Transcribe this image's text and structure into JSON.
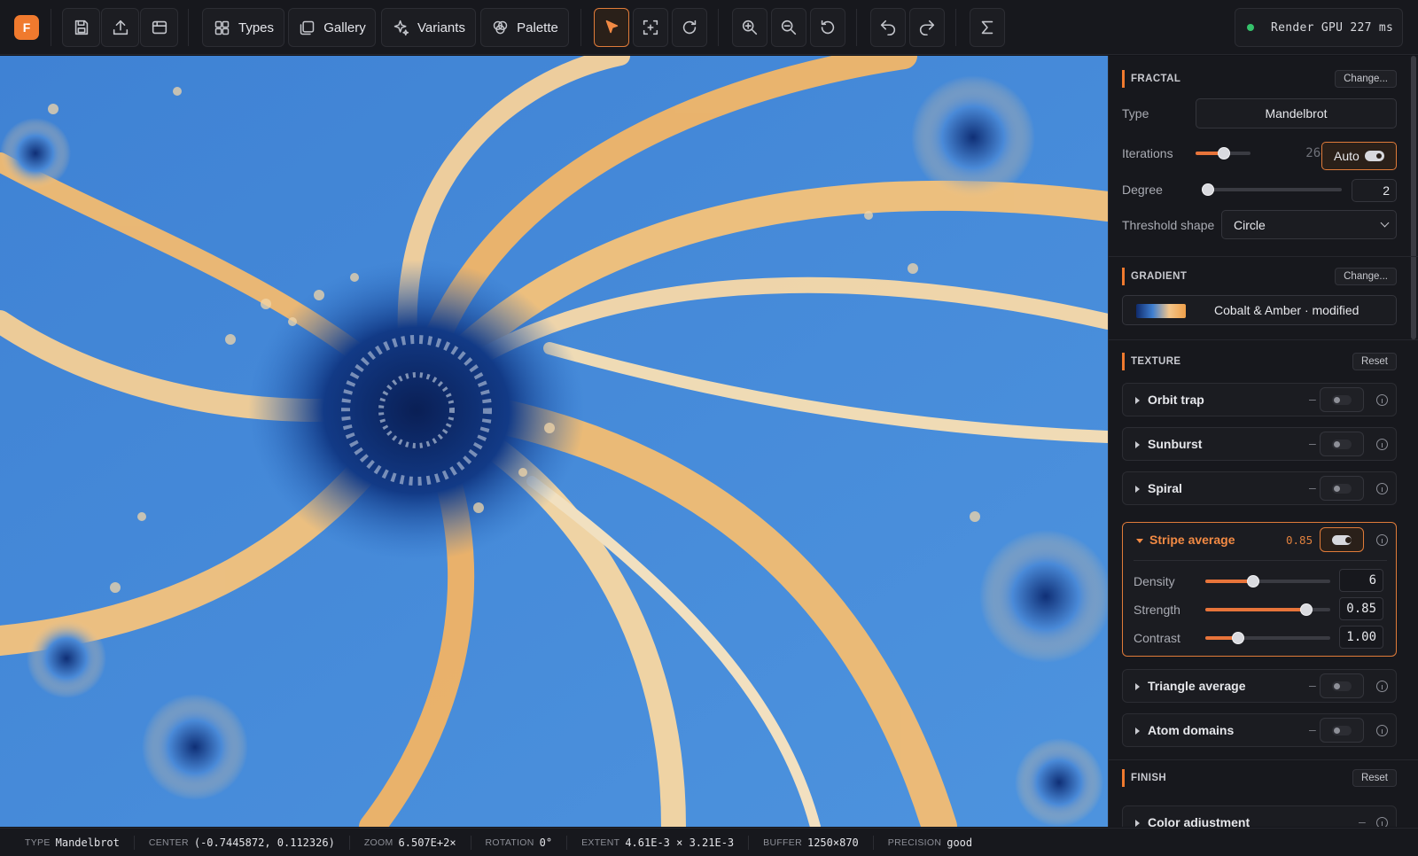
{
  "app": {
    "logo_letter": "F"
  },
  "toolbar": {
    "types_label": "Types",
    "gallery_label": "Gallery",
    "variants_label": "Variants",
    "palette_label": "Palette",
    "render_status": "Render GPU 227 ms",
    "render_status_color": "#35c26b",
    "accent_color": "#f07a2e"
  },
  "panel": {
    "fractal": {
      "section_title": "FRACTAL",
      "change_label": "Change...",
      "type_label": "Type",
      "type_value": "Mandelbrot",
      "iterations_label": "Iterations",
      "iterations_value": "2648",
      "iterations_level": 0.52,
      "auto_label": "Auto",
      "degree_label": "Degree",
      "degree_value": "2",
      "degree_level": 0.0,
      "threshold_label": "Threshold shape",
      "threshold_value": "Circle"
    },
    "gradient": {
      "section_title": "GRADIENT",
      "change_label": "Change...",
      "name": "Cobalt & Amber · modified",
      "swatch_colors": [
        "#0f2a6b",
        "#3f7fd1",
        "#f3c58a",
        "#f0a04a"
      ]
    },
    "texture": {
      "section_title": "TEXTURE",
      "reset_label": "Reset",
      "items": [
        {
          "name": "Orbit trap",
          "value": "–",
          "enabled": false
        },
        {
          "name": "Sunburst",
          "value": "–",
          "enabled": false
        },
        {
          "name": "Spiral",
          "value": "–",
          "enabled": false
        }
      ],
      "stripe": {
        "name": "Stripe average",
        "value": "0.85",
        "enabled": true,
        "params": [
          {
            "label": "Density",
            "value": "6",
            "level": 0.38
          },
          {
            "label": "Strength",
            "value": "0.85",
            "level": 0.81
          },
          {
            "label": "Contrast",
            "value": "1.00",
            "level": 0.26
          }
        ]
      },
      "items_after": [
        {
          "name": "Triangle average",
          "value": "–",
          "enabled": false
        },
        {
          "name": "Atom domains",
          "value": "–",
          "enabled": false
        }
      ]
    },
    "finish": {
      "section_title": "FINISH",
      "reset_label": "Reset",
      "items": [
        {
          "name": "Color adjustment",
          "value": "–"
        }
      ]
    }
  },
  "statusbar": {
    "type_key": "TYPE",
    "type_val": "Mandelbrot",
    "center_key": "CENTER",
    "center_val": "(-0.7445872, 0.112326)",
    "zoom_key": "ZOOM",
    "zoom_val": "6.507E+2×",
    "rotation_key": "ROTATION",
    "rotation_val": "0°",
    "extent_key": "EXTENT",
    "extent_val": "4.61E-3 × 3.21E-3",
    "buffer_key": "BUFFER",
    "buffer_val": "1250×870",
    "precision_key": "PRECISION",
    "precision_val": "good"
  }
}
